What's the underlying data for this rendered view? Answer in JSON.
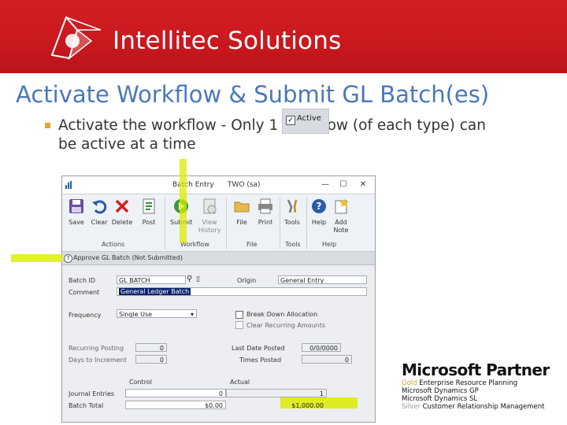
{
  "brand": {
    "name": "Intellitec Solutions"
  },
  "slide": {
    "title": "Activate Workflow & Submit GL Batch(es)",
    "bullet": "Activate the workflow - Only 1 workflow (of each type) can be active at a time",
    "active_checkbox_label": "Active"
  },
  "window": {
    "title": "Batch Entry",
    "user": "TWO (sa)",
    "controls": [
      "—",
      "☐",
      "✕"
    ],
    "ribbon": {
      "buttons": [
        {
          "label": "Save",
          "icon": "save-icon"
        },
        {
          "label": "Clear",
          "icon": "undo-icon"
        },
        {
          "label": "Delete",
          "icon": "delete-icon"
        },
        {
          "label": "Post",
          "icon": "post-icon"
        },
        {
          "label": "Submit",
          "icon": "submit-icon"
        },
        {
          "label": "View History",
          "icon": "history-icon"
        },
        {
          "label": "File",
          "icon": "folder-icon"
        },
        {
          "label": "Print",
          "icon": "printer-icon"
        },
        {
          "label": "Tools",
          "icon": "tools-icon"
        },
        {
          "label": "Help",
          "icon": "help-icon"
        },
        {
          "label": "Add Note",
          "icon": "note-icon"
        }
      ],
      "groups": [
        "Actions",
        "Workflow",
        "File",
        "Tools",
        "Help"
      ]
    },
    "status": "Approve GL Batch (Not Submitted)",
    "form": {
      "batch_id_label": "Batch ID",
      "batch_id": "GL BATCH",
      "origin_label": "Origin",
      "origin": "General Entry",
      "comment_label": "Comment",
      "comment": "General Ledger Batch",
      "frequency_label": "Frequency",
      "frequency": "Single Use",
      "break_down_label": "Break Down Allocation",
      "clear_recurring_label": "Clear Recurring Amounts",
      "recurring_posting_label": "Recurring Posting",
      "recurring_posting": "0",
      "days_to_increment_label": "Days to Increment",
      "days_to_increment": "0",
      "last_date_posted_label": "Last Date Posted",
      "last_date_posted": "0/0/0000",
      "times_posted_label": "Times Posted",
      "times_posted": "0",
      "control_header": "Control",
      "actual_header": "Actual",
      "journal_entries_label": "Journal Entries",
      "journal_control": "0",
      "journal_actual": "1",
      "batch_total_label": "Batch Total",
      "batch_total_control": "$0.00",
      "batch_total_actual": "$1,000.00"
    }
  },
  "partner": {
    "title": "Microsoft Partner",
    "tier_gold": "Gold",
    "line1": "Enterprise Resource Planning",
    "line2": "Microsoft Dynamics GP",
    "line3": "Microsoft Dynamics SL",
    "tier_silver": "Silver",
    "line4": "Customer Relationship Management"
  },
  "colors": {
    "banner": "#c9181e",
    "title": "#4a78b8",
    "bullet": "#e2a336",
    "highlight": "#dceb00"
  }
}
